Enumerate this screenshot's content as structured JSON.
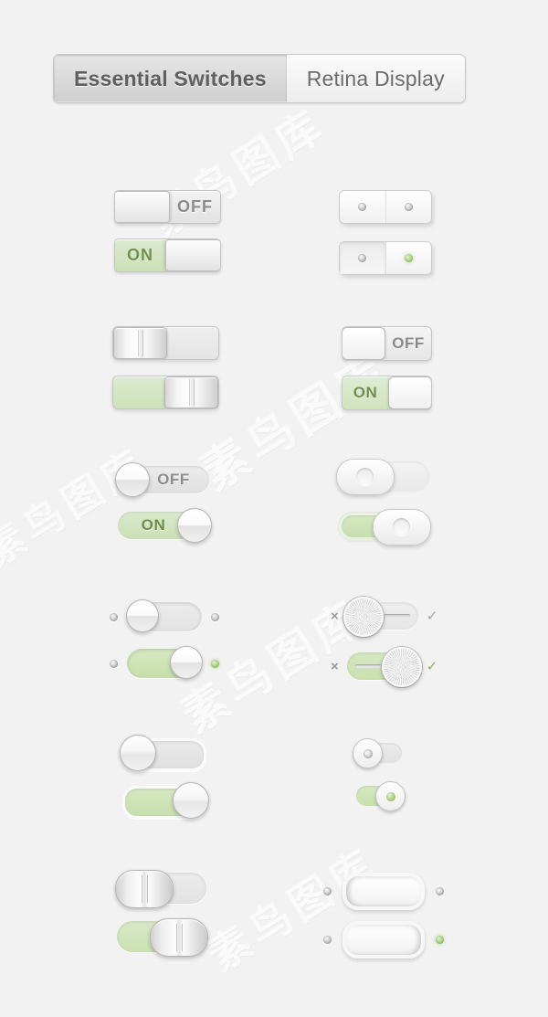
{
  "page": {
    "background_color": "#f2f2f2",
    "accent_green": "#cbe0b6",
    "accent_green_text": "#6f8d4c",
    "led_green": "#9ccb6c",
    "label_gray": "#8b8b8b",
    "watermark_text": "素鸟图库"
  },
  "header": {
    "tabs": [
      {
        "label": "Essential Switches",
        "active": true
      },
      {
        "label": "Retina Display",
        "active": false
      }
    ]
  },
  "rows": [
    {
      "row_id": "row-1",
      "left": {
        "style": "rect-label-square-knob",
        "off": {
          "label": "OFF",
          "state": "off"
        },
        "on": {
          "label": "ON",
          "state": "on"
        }
      },
      "right": {
        "style": "dual-panel-led",
        "off": {
          "led_left": "gray",
          "led_right": "gray",
          "state": "off"
        },
        "on": {
          "led_left": "gray",
          "led_right": "green",
          "state": "on"
        }
      }
    },
    {
      "row_id": "row-2",
      "left": {
        "style": "rect-grooved-knob",
        "off": {
          "state": "off"
        },
        "on": {
          "state": "on"
        }
      },
      "right": {
        "style": "rounded-rect-label",
        "off": {
          "label": "OFF",
          "state": "off"
        },
        "on": {
          "label": "ON",
          "state": "on"
        }
      }
    },
    {
      "row_id": "row-3",
      "left": {
        "style": "pill-label-round-knob",
        "off": {
          "label": "OFF",
          "state": "off"
        },
        "on": {
          "label": "ON",
          "state": "on"
        }
      },
      "right": {
        "style": "pill-dimpled-oval-knob",
        "off": {
          "state": "off"
        },
        "on": {
          "state": "on"
        }
      }
    },
    {
      "row_id": "row-4",
      "left": {
        "style": "pill-outer-leds",
        "off": {
          "led_left": "gray",
          "led_right": "gray",
          "state": "off"
        },
        "on": {
          "led_left": "gray",
          "led_right": "green",
          "state": "on"
        }
      },
      "right": {
        "style": "metal-knob-x-check",
        "off": {
          "icon_left": "×",
          "icon_right": "✓",
          "check_active": false,
          "state": "off"
        },
        "on": {
          "icon_left": "×",
          "icon_right": "✓",
          "check_active": true,
          "state": "on"
        }
      }
    },
    {
      "row_id": "row-5",
      "left": {
        "style": "inset-pill-round-knob",
        "off": {
          "state": "off"
        },
        "on": {
          "state": "on"
        }
      },
      "right": {
        "style": "small-pill-dot-knob",
        "off": {
          "dot": "gray",
          "state": "off"
        },
        "on": {
          "dot": "green",
          "state": "on"
        }
      }
    },
    {
      "row_id": "row-6",
      "left": {
        "style": "pill-grooved-oval-knob",
        "off": {
          "state": "off"
        },
        "on": {
          "state": "on"
        }
      },
      "right": {
        "style": "rocker-pill-leds",
        "off": {
          "led_left": "gray",
          "led_right": "gray",
          "state": "off"
        },
        "on": {
          "led_left": "gray",
          "led_right": "green",
          "state": "on"
        }
      }
    }
  ]
}
